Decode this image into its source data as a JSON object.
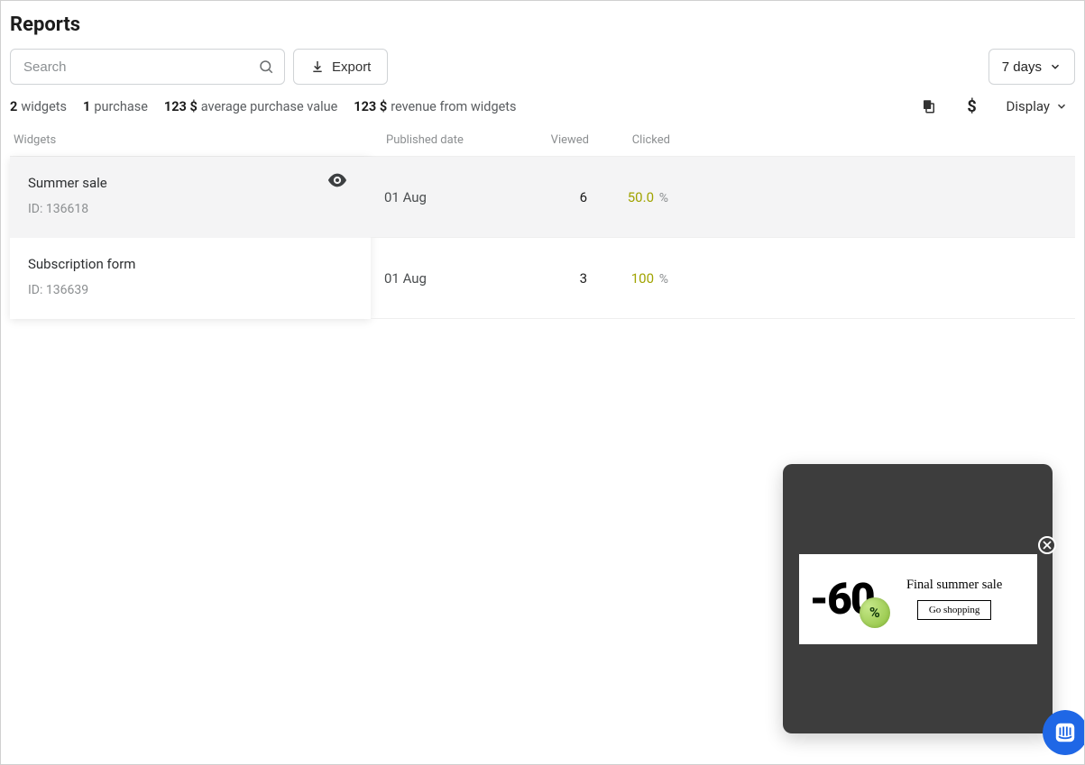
{
  "title": "Reports",
  "search": {
    "placeholder": "Search"
  },
  "export_label": "Export",
  "range_label": "7 days",
  "stats": {
    "widgets_count": "2",
    "widgets_label": "widgets",
    "purchase_count": "1",
    "purchase_label": "purchase",
    "avg_value": "123 $",
    "avg_label": "average purchase value",
    "revenue_value": "123 $",
    "revenue_label": "revenue from widgets"
  },
  "currency_symbol": "$",
  "display_label": "Display",
  "columns": {
    "widgets": "Widgets",
    "published": "Published date",
    "viewed": "Viewed",
    "clicked": "Clicked"
  },
  "rows": [
    {
      "name": "Summer sale",
      "id_label": "ID: 136618",
      "published": "01 Aug",
      "viewed": "6",
      "clicked_val": "50.0",
      "clicked_pct": "%",
      "selected": true
    },
    {
      "name": "Subscription form",
      "id_label": "ID: 136639",
      "published": "01 Aug",
      "viewed": "3",
      "clicked_val": "100",
      "clicked_pct": "%",
      "selected": false
    }
  ],
  "preview": {
    "discount": "-60",
    "pct": "%",
    "headline": "Final summer sale",
    "cta": "Go shopping"
  }
}
